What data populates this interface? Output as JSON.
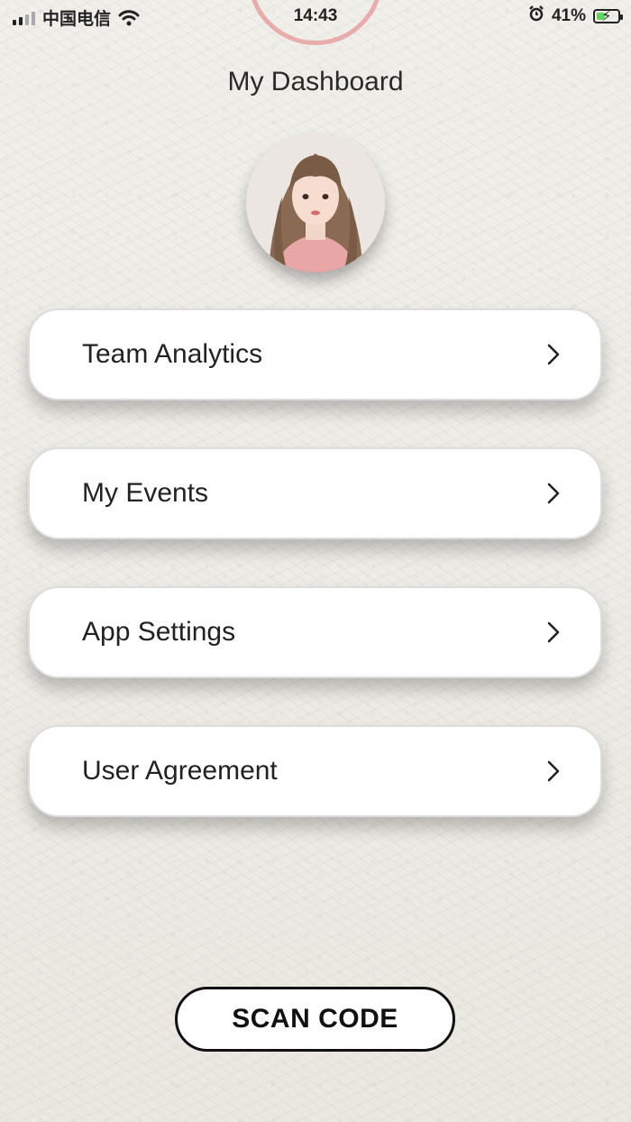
{
  "status_bar": {
    "carrier": "中国电信",
    "time": "14:43",
    "battery_percent": "41%",
    "battery_level": 0.41,
    "icons": [
      "signal-icon",
      "wifi-icon",
      "alarm-icon",
      "battery-icon"
    ]
  },
  "header": {
    "title": "My Dashboard"
  },
  "menu": {
    "items": [
      {
        "label": "Team Analytics"
      },
      {
        "label": "My Events"
      },
      {
        "label": "App Settings"
      },
      {
        "label": "User Agreement"
      }
    ]
  },
  "actions": {
    "scan_label": "SCAN CODE"
  },
  "colors": {
    "background": "#efede8",
    "card": "#ffffff",
    "text": "#222222",
    "battery_fill": "#5fd45f",
    "record_ring": "#e17878"
  }
}
